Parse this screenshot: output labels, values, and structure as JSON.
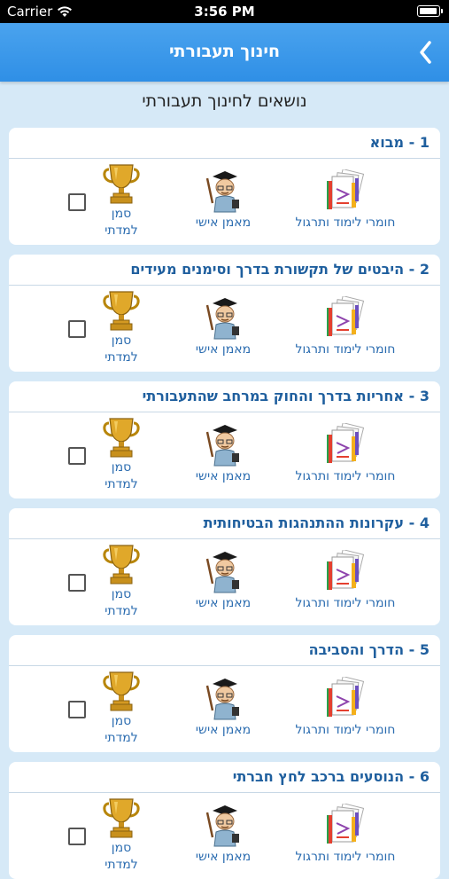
{
  "status_bar": {
    "carrier": "Carrier",
    "time": "3:56 PM"
  },
  "nav": {
    "title": "חינוך תעבורתי"
  },
  "page": {
    "section_title": "נושאים לחינוך תעבורתי"
  },
  "actions": {
    "materials": "חומרי לימוד ותרגול",
    "coach": "מאמן אישי",
    "mark_line1": "סמן",
    "mark_line2": "למדתי"
  },
  "topics": [
    {
      "title": "1 - מבוא",
      "checked": false
    },
    {
      "title": "2 - היבטים של תקשורת בדרך וסימנים מעידים",
      "checked": false
    },
    {
      "title": "3 - אחריות בדרך והחוק במרחב שהתעבורתי",
      "checked": false
    },
    {
      "title": "4 - עקרונות ההתנהגות הבטיחותית",
      "checked": false
    },
    {
      "title": "5 - הדרך והסביבה",
      "checked": false
    },
    {
      "title": "6 - הנוסעים ברכב לחץ חברתי",
      "checked": false
    }
  ],
  "colors": {
    "nav": "#3597e9",
    "background": "#d6e9f7",
    "link": "#2b6cb0",
    "header_text": "#1f5f9e"
  },
  "icons": {
    "materials": "books-icon",
    "coach": "coach-icon",
    "trophy": "trophy-icon",
    "back": "chevron-left-icon",
    "wifi": "wifi-icon",
    "battery": "battery-icon"
  }
}
